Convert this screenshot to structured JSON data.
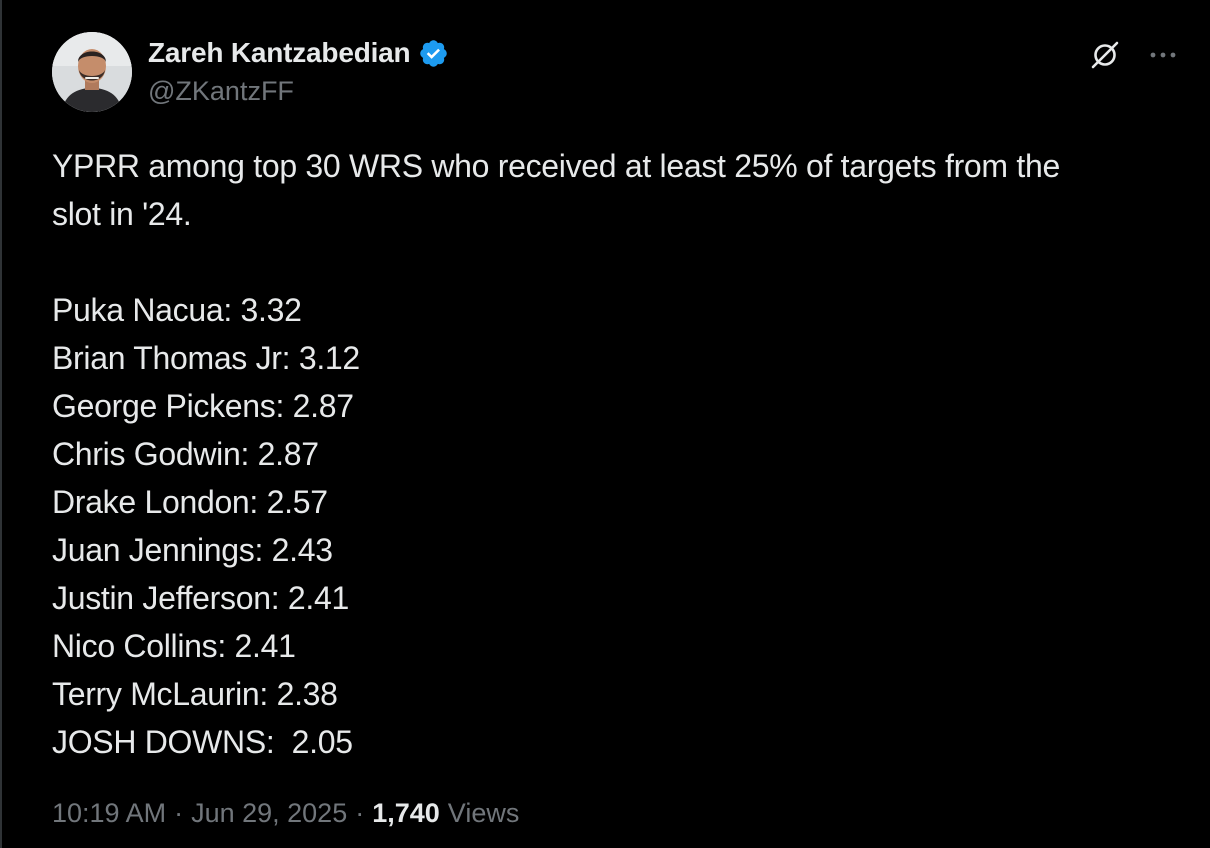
{
  "tweet": {
    "author": {
      "display_name": "Zareh Kantzabedian",
      "handle": "@ZKantzFF",
      "verified_icon": "verified-badge-icon"
    },
    "icons": {
      "grok": "grok-icon",
      "more": "more-horizontal-icon"
    },
    "text": {
      "intro_line_1": "YPRR among top 30 WRS who received at least 25% of targets from the",
      "intro_line_2": "slot in '24.",
      "players": [
        "Puka Nacua: 3.32",
        "Brian Thomas Jr: 3.12",
        "George Pickens: 2.87",
        "Chris Godwin: 2.87",
        "Drake London: 2.57",
        "Juan Jennings: 2.43",
        "Justin Jefferson: 2.41",
        "Nico Collins: 2.41",
        "Terry McLaurin: 2.38",
        "JOSH DOWNS:  2.05"
      ]
    },
    "meta": {
      "time": "10:19 AM",
      "separator": "·",
      "date": "Jun 29, 2025",
      "views_count": "1,740",
      "views_label": "Views"
    }
  },
  "colors": {
    "background": "#000000",
    "text_primary": "#e7e9ea",
    "text_secondary": "#71767b",
    "verified_blue": "#1d9bf0"
  }
}
